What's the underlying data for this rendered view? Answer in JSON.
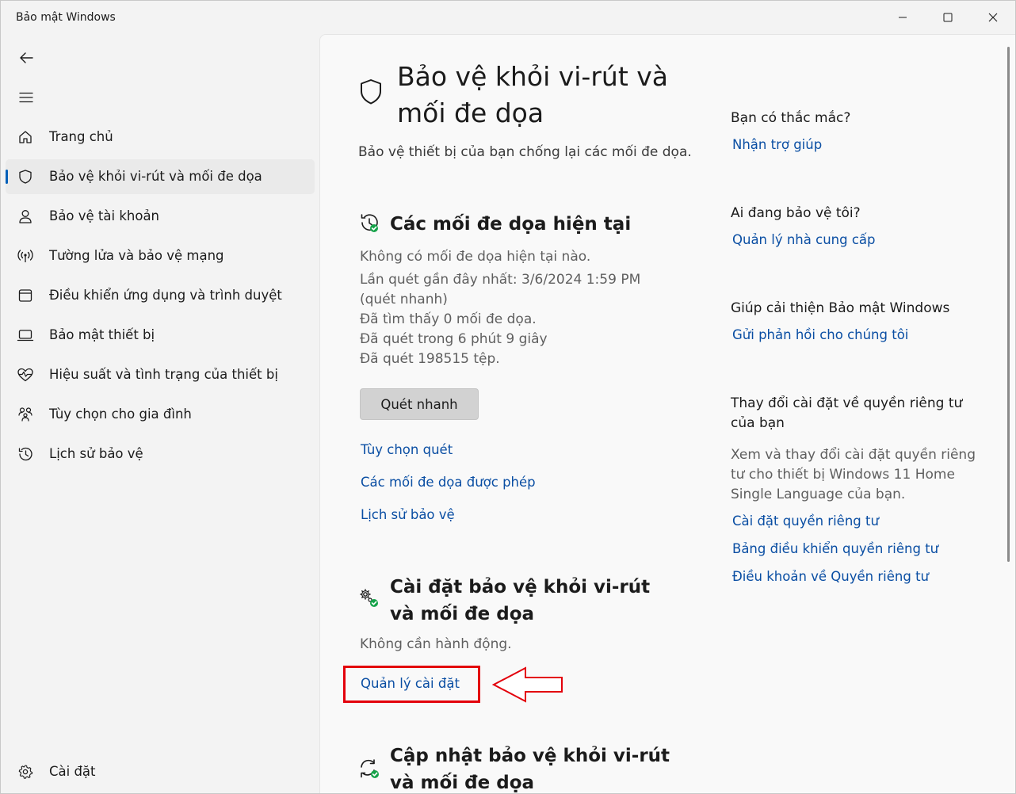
{
  "window": {
    "title": "Bảo mật Windows",
    "controls": [
      "minimize",
      "maximize",
      "close"
    ]
  },
  "sidebar": {
    "back_icon": "back-arrow-icon",
    "menu_icon": "hamburger-icon",
    "items": [
      {
        "label": "Trang chủ",
        "icon": "home-icon",
        "active": false
      },
      {
        "label": "Bảo vệ khỏi vi-rút và mối đe dọa",
        "icon": "shield-icon",
        "active": true
      },
      {
        "label": "Bảo vệ tài khoản",
        "icon": "person-icon",
        "active": false
      },
      {
        "label": "Tường lửa và bảo vệ mạng",
        "icon": "wifi-antenna-icon",
        "active": false
      },
      {
        "label": "Điều khiển ứng dụng và trình duyệt",
        "icon": "browser-window-icon",
        "active": false
      },
      {
        "label": "Bảo mật thiết bị",
        "icon": "laptop-icon",
        "active": false
      },
      {
        "label": "Hiệu suất và tình trạng của thiết bị",
        "icon": "heart-pulse-icon",
        "active": false
      },
      {
        "label": "Tùy chọn cho gia đình",
        "icon": "family-icon",
        "active": false
      },
      {
        "label": "Lịch sử bảo vệ",
        "icon": "history-icon",
        "active": false
      }
    ],
    "settings_label": "Cài đặt"
  },
  "main": {
    "title": "Bảo vệ khỏi vi-rút và mối đe dọa",
    "subtitle": "Bảo vệ thiết bị của bạn chống lại các mối đe dọa.",
    "current_threats": {
      "title": "Các mối đe dọa hiện tại",
      "lines": [
        "Không có mối đe dọa hiện tại nào.",
        "Lần quét gần đây nhất: 3/6/2024 1:59 PM (quét nhanh)",
        "Đã tìm thấy 0 mối đe dọa.",
        "Đã quét trong 6 phút 9 giây",
        "Đã quét 198515 tệp."
      ],
      "quick_scan_button": "Quét nhanh",
      "links": [
        "Tùy chọn quét",
        "Các mối đe dọa được phép",
        "Lịch sử bảo vệ"
      ]
    },
    "settings_section": {
      "title": "Cài đặt bảo vệ khỏi vi-rút và mối đe dọa",
      "status": "Không cần hành động.",
      "manage_link": "Quản lý cài đặt"
    },
    "updates_section": {
      "title": "Cập nhật bảo vệ khỏi vi-rút và mối đe dọa"
    }
  },
  "aside": {
    "blocks": [
      {
        "heading": "Bạn có thắc mắc?",
        "links": [
          "Nhận trợ giúp"
        ]
      },
      {
        "heading": "Ai đang bảo vệ tôi?",
        "links": [
          "Quản lý nhà cung cấp"
        ]
      },
      {
        "heading": "Giúp cải thiện Bảo mật Windows",
        "links": [
          "Gửi phản hồi cho chúng tôi"
        ]
      },
      {
        "heading": "Thay đổi cài đặt về quyền riêng tư của bạn",
        "text": "Xem và thay đổi cài đặt quyền riêng tư cho thiết bị Windows 11 Home Single Language của bạn.",
        "links": [
          "Cài đặt quyền riêng tư",
          "Bảng điều khiển quyền riêng tư",
          "Điều khoản về Quyền riêng tư"
        ]
      }
    ]
  },
  "colors": {
    "accent": "#005fb8",
    "link": "#0a4ea3",
    "status_ok": "#16a34a",
    "annotation": "#e3000b"
  }
}
